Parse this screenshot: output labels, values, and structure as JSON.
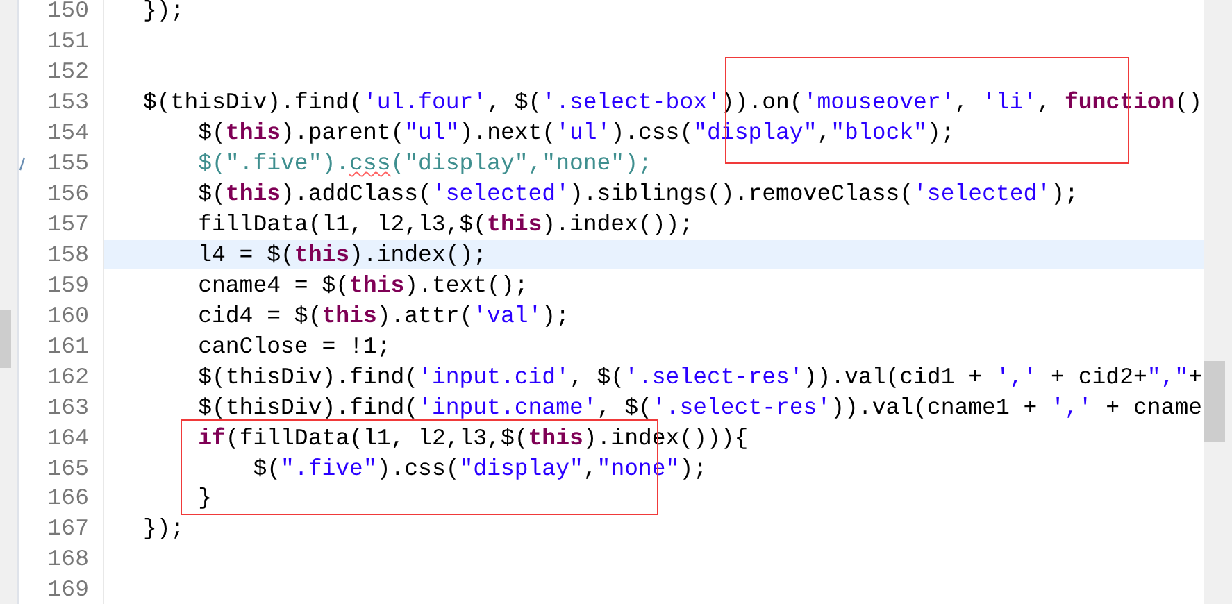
{
  "editor": {
    "lines": [
      {
        "number": "150",
        "current": false,
        "changed": false,
        "tokens": [
          {
            "kind": "plain",
            "text": "});"
          }
        ]
      },
      {
        "number": "151",
        "current": false,
        "changed": false
      },
      {
        "number": "152",
        "current": false,
        "changed": false
      },
      {
        "number": "153",
        "current": false,
        "changed": false,
        "tokens": [
          {
            "kind": "plain",
            "text": "$(thisDiv).find("
          },
          {
            "kind": "string",
            "text": "'ul.four'"
          },
          {
            "kind": "plain",
            "text": ", $("
          },
          {
            "kind": "string",
            "text": "'.select-box'"
          },
          {
            "kind": "plain",
            "text": ")).on("
          },
          {
            "kind": "string",
            "text": "'mouseover'"
          },
          {
            "kind": "plain",
            "text": ", "
          },
          {
            "kind": "string",
            "text": "'li'"
          },
          {
            "kind": "plain",
            "text": ", "
          },
          {
            "kind": "keyword",
            "text": "function"
          },
          {
            "kind": "plain",
            "text": "()"
          }
        ]
      },
      {
        "number": "154",
        "current": false,
        "changed": false,
        "tokens": [
          {
            "kind": "plain",
            "text": "    $("
          },
          {
            "kind": "keyword",
            "text": "this"
          },
          {
            "kind": "plain",
            "text": ").parent("
          },
          {
            "kind": "string",
            "text": "\"ul\""
          },
          {
            "kind": "plain",
            "text": ").next("
          },
          {
            "kind": "string",
            "text": "'ul'"
          },
          {
            "kind": "plain",
            "text": ").css("
          },
          {
            "kind": "string",
            "text": "\"display\""
          },
          {
            "kind": "plain",
            "text": ","
          },
          {
            "kind": "string",
            "text": "\"block\""
          },
          {
            "kind": "plain",
            "text": ");"
          }
        ]
      },
      {
        "number": "155",
        "current": false,
        "changed": true,
        "tokens": [
          {
            "kind": "dim",
            "text": "    $(\".five\")."
          },
          {
            "kind": "warning",
            "text": "css"
          },
          {
            "kind": "dim",
            "text": "(\"display\",\"none\");"
          }
        ]
      },
      {
        "number": "156",
        "current": false,
        "changed": false,
        "tokens": [
          {
            "kind": "plain",
            "text": "    $("
          },
          {
            "kind": "keyword",
            "text": "this"
          },
          {
            "kind": "plain",
            "text": ").addClass("
          },
          {
            "kind": "string",
            "text": "'selected'"
          },
          {
            "kind": "plain",
            "text": ").siblings().removeClass("
          },
          {
            "kind": "string",
            "text": "'selected'"
          },
          {
            "kind": "plain",
            "text": ");"
          }
        ]
      },
      {
        "number": "157",
        "current": false,
        "changed": false,
        "tokens": [
          {
            "kind": "plain",
            "text": "    fillData(l1, l2,l3,$("
          },
          {
            "kind": "keyword",
            "text": "this"
          },
          {
            "kind": "plain",
            "text": ").index());"
          }
        ]
      },
      {
        "number": "158",
        "current": true,
        "changed": false,
        "tokens": [
          {
            "kind": "plain",
            "text": "    l4 = $("
          },
          {
            "kind": "keyword",
            "text": "this"
          },
          {
            "kind": "plain",
            "text": ").index();"
          }
        ]
      },
      {
        "number": "159",
        "current": false,
        "changed": false,
        "tokens": [
          {
            "kind": "plain",
            "text": "    cname4 = $("
          },
          {
            "kind": "keyword",
            "text": "this"
          },
          {
            "kind": "plain",
            "text": ").text();"
          }
        ]
      },
      {
        "number": "160",
        "current": false,
        "changed": false,
        "tokens": [
          {
            "kind": "plain",
            "text": "    cid4 = $("
          },
          {
            "kind": "keyword",
            "text": "this"
          },
          {
            "kind": "plain",
            "text": ").attr("
          },
          {
            "kind": "string",
            "text": "'val'"
          },
          {
            "kind": "plain",
            "text": ");"
          }
        ]
      },
      {
        "number": "161",
        "current": false,
        "changed": false,
        "tokens": [
          {
            "kind": "plain",
            "text": "    canClose = !1;"
          }
        ]
      },
      {
        "number": "162",
        "current": false,
        "changed": false,
        "tokens": [
          {
            "kind": "plain",
            "text": "    $(thisDiv).find("
          },
          {
            "kind": "string",
            "text": "'input.cid'"
          },
          {
            "kind": "plain",
            "text": ", $("
          },
          {
            "kind": "string",
            "text": "'.select-res'"
          },
          {
            "kind": "plain",
            "text": ")).val(cid1 + "
          },
          {
            "kind": "string",
            "text": "','"
          },
          {
            "kind": "plain",
            "text": " + cid2+"
          },
          {
            "kind": "string",
            "text": "\",\""
          },
          {
            "kind": "plain",
            "text": "+"
          }
        ]
      },
      {
        "number": "163",
        "current": false,
        "changed": false,
        "tokens": [
          {
            "kind": "plain",
            "text": "    $(thisDiv).find("
          },
          {
            "kind": "string",
            "text": "'input.cname'"
          },
          {
            "kind": "plain",
            "text": ", $("
          },
          {
            "kind": "string",
            "text": "'.select-res'"
          },
          {
            "kind": "plain",
            "text": ")).val(cname1 + "
          },
          {
            "kind": "string",
            "text": "','"
          },
          {
            "kind": "plain",
            "text": " + cname"
          }
        ]
      },
      {
        "number": "164",
        "current": false,
        "changed": false,
        "tokens": [
          {
            "kind": "keyword",
            "text": "    if"
          },
          {
            "kind": "plain",
            "text": "(fillData(l1, l2,l3,$("
          },
          {
            "kind": "keyword",
            "text": "this"
          },
          {
            "kind": "plain",
            "text": ").index())){"
          }
        ]
      },
      {
        "number": "165",
        "current": false,
        "changed": false,
        "tokens": [
          {
            "kind": "plain",
            "text": "        $("
          },
          {
            "kind": "string",
            "text": "\".five\""
          },
          {
            "kind": "plain",
            "text": ").css("
          },
          {
            "kind": "string",
            "text": "\"display\""
          },
          {
            "kind": "plain",
            "text": ","
          },
          {
            "kind": "string",
            "text": "\"none\""
          },
          {
            "kind": "plain",
            "text": ");"
          }
        ]
      },
      {
        "number": "166",
        "current": false,
        "changed": false,
        "tokens": [
          {
            "kind": "plain",
            "text": "    }"
          }
        ]
      },
      {
        "number": "167",
        "current": false,
        "changed": false,
        "tokens": [
          {
            "kind": "plain",
            "text": "});"
          }
        ]
      },
      {
        "number": "168",
        "current": false,
        "changed": false
      },
      {
        "number": "169",
        "current": false,
        "changed": false
      }
    ]
  }
}
